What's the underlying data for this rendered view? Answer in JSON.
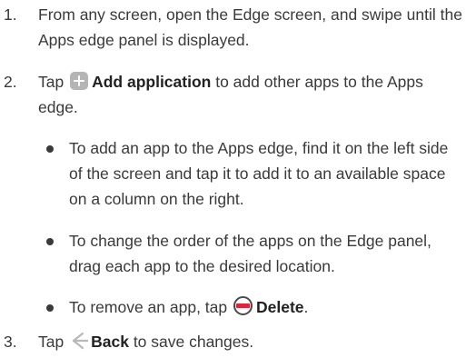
{
  "steps": [
    {
      "number": "1.",
      "text": "From any screen, open the Edge screen, and swipe until the Apps edge panel is displayed."
    },
    {
      "number": "2.",
      "pre": "Tap",
      "icon": "plus-icon",
      "bold": "Add application",
      "post": "to add other apps to the Apps edge."
    },
    {
      "number": "3.",
      "pre": "Tap",
      "icon": "back-arrow-icon",
      "bold": "Back",
      "post": "to save changes."
    }
  ],
  "bullets": [
    {
      "text": "To add an app to the Apps edge, find it on the left side of the screen and tap it to add it to an available space on a column on the right."
    },
    {
      "text": "To change the order of the apps on the Edge panel, drag each app to the desired location."
    },
    {
      "pre": "To remove an app, tap",
      "icon": "minus-circle-icon",
      "bold": "Delete",
      "post": "."
    }
  ],
  "colors": {
    "text": "#3a3a3a",
    "plus_icon_bg": "#b5b5b5",
    "delete_icon_red": "#e0233a",
    "back_icon": "#b8b8b8"
  }
}
